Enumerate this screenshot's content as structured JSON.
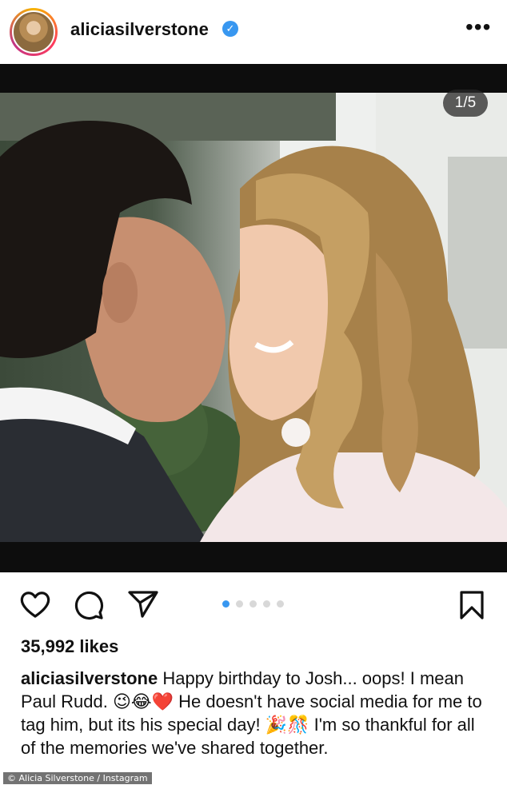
{
  "header": {
    "username": "aliciasilverstone",
    "verified_mark": "✓",
    "more_label": "•••"
  },
  "media": {
    "counter": "1/5",
    "image_desc": "couple-photo"
  },
  "actions": {
    "like_icon": "heart-icon",
    "comment_icon": "comment-icon",
    "share_icon": "send-icon",
    "save_icon": "bookmark-icon",
    "carousel_count": 5,
    "carousel_active": 0,
    "accent": "#3897f0"
  },
  "post": {
    "likes": "35,992 likes",
    "caption_user": "aliciasilverstone",
    "caption_text": " Happy birthday to Josh... oops! I mean Paul Rudd. 😉😂❤️  He doesn't have social media for me to tag him, but its his special day! 🎉🎊 I'm so thankful for all of the memories we've shared together."
  },
  "credit": "© Alicia Silverstone / Instagram"
}
